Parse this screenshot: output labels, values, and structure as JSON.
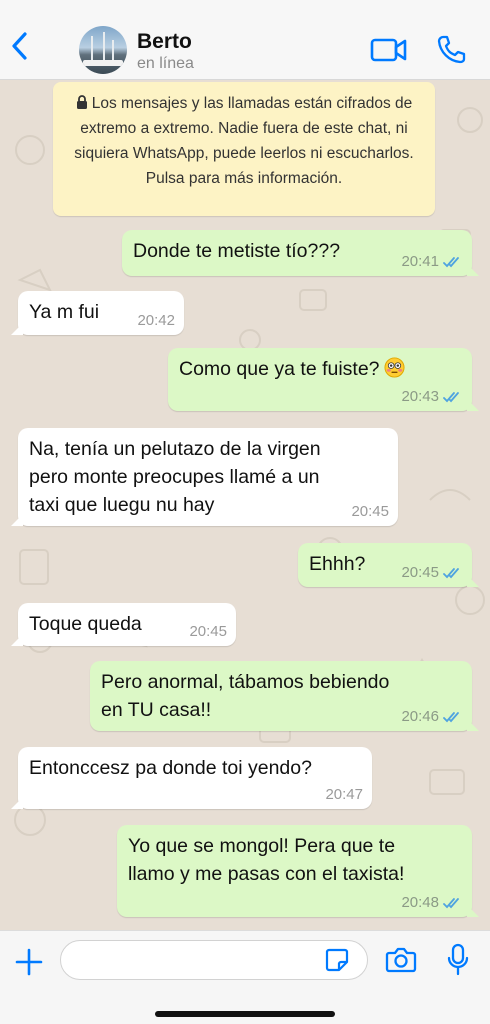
{
  "header": {
    "contact_name": "Berto",
    "status": "en línea"
  },
  "system_notice": {
    "text": "Los mensajes y las llamadas están cifrados de extremo a extremo. Nadie fuera de este chat, ni siquiera WhatsApp, puede leerlos ni escucharlos. Pulsa para más información.",
    "icon": "lock-icon"
  },
  "messages": [
    {
      "direction": "out",
      "lines": [
        "Donde te metiste tío???"
      ],
      "time": "20:41",
      "read": true
    },
    {
      "direction": "in",
      "lines": [
        "Ya m fui"
      ],
      "time": "20:42"
    },
    {
      "direction": "out",
      "lines": [
        "Como que ya te fuiste?"
      ],
      "emoji": "flushed-face-emoji",
      "time": "20:43",
      "read": true
    },
    {
      "direction": "in",
      "lines": [
        "Na, tenía un pelutazo de la virgen",
        "pero monte preocupes llamé a un",
        "taxi que luegu nu hay"
      ],
      "time": "20:45"
    },
    {
      "direction": "out",
      "lines": [
        "Ehhh?"
      ],
      "time": "20:45",
      "read": true
    },
    {
      "direction": "in",
      "lines": [
        "Toque queda"
      ],
      "time": "20:45"
    },
    {
      "direction": "out",
      "lines": [
        "Pero anormal, tábamos bebiendo",
        "en TU casa!!"
      ],
      "time": "20:46",
      "read": true
    },
    {
      "direction": "in",
      "lines": [
        "Entonccesz pa donde toi yendo?"
      ],
      "time": "20:47"
    },
    {
      "direction": "out",
      "lines": [
        "Yo que se mongol! Pera que te",
        "llamo y me pasas con el taxista!"
      ],
      "time": "20:48",
      "read": true
    }
  ],
  "input": {
    "placeholder": "",
    "value": ""
  },
  "colors": {
    "accent": "#007aff",
    "outgoing_bubble": "#dcf8c6",
    "incoming_bubble": "#ffffff",
    "notice": "#fdf3c5",
    "read_ticks": "#4fa3e0",
    "chat_background": "#e7ded4"
  }
}
